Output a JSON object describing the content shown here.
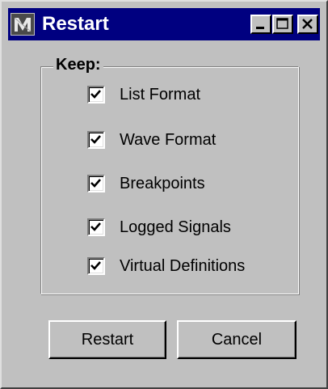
{
  "window": {
    "title": "Restart",
    "icons": {
      "app": "app-logo-icon",
      "minimize": "minimize-icon",
      "maximize": "maximize-icon",
      "close": "close-icon"
    },
    "colors": {
      "titlebar": "#000080",
      "face": "#c0c0c0",
      "title_text": "#ffffff"
    }
  },
  "keep": {
    "label": "Keep:",
    "options": [
      {
        "label": "List Format",
        "checked": true
      },
      {
        "label": "Wave Format",
        "checked": true
      },
      {
        "label": "Breakpoints",
        "checked": true
      },
      {
        "label": "Logged Signals",
        "checked": true
      },
      {
        "label": "Virtual Definitions",
        "checked": true
      }
    ]
  },
  "buttons": {
    "restart": "Restart",
    "cancel": "Cancel"
  }
}
